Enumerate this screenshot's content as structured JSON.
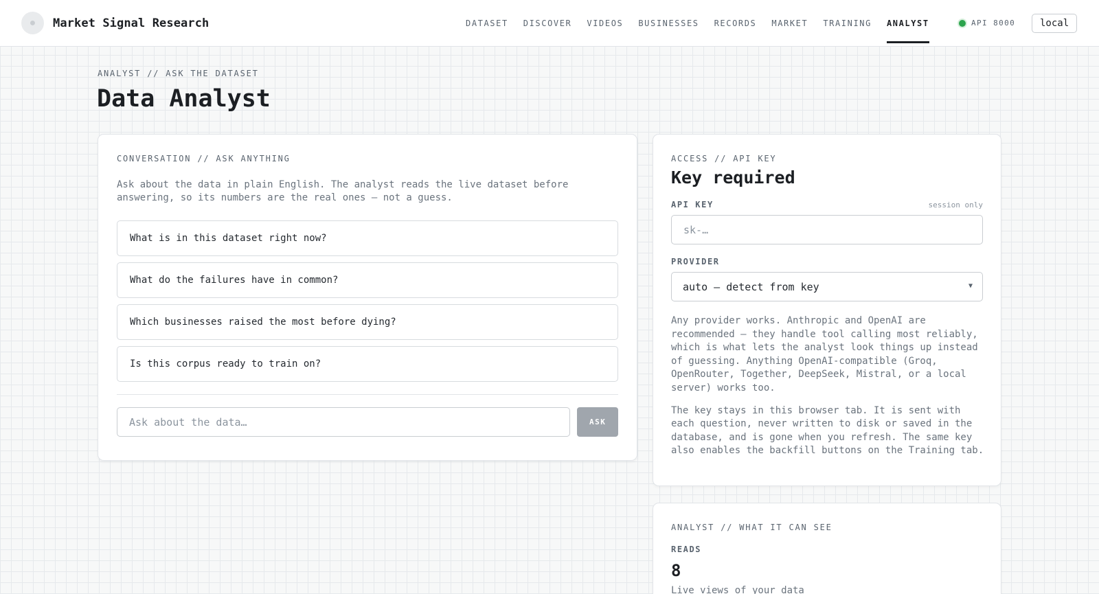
{
  "brand": {
    "name": "Market Signal Research",
    "logo_icon": "brand-logo-icon"
  },
  "nav": {
    "items": [
      {
        "label": "DATASET",
        "active": false
      },
      {
        "label": "DISCOVER",
        "active": false
      },
      {
        "label": "VIDEOS",
        "active": false
      },
      {
        "label": "BUSINESSES",
        "active": false
      },
      {
        "label": "RECORDS",
        "active": false
      },
      {
        "label": "MARKET",
        "active": false
      },
      {
        "label": "TRAINING",
        "active": false
      },
      {
        "label": "ANALYST",
        "active": true
      }
    ],
    "api_status": "API 8000",
    "api_status_color": "#2da44e",
    "env": "local"
  },
  "page": {
    "eyebrow": "ANALYST // ASK THE DATASET",
    "title": "Data Analyst"
  },
  "conversation": {
    "eyebrow": "CONVERSATION // ASK ANYTHING",
    "intro": "Ask about the data in plain English. The analyst reads the live dataset before answering, so its numbers are the real ones — not a guess.",
    "suggestions": [
      "What is in this dataset right now?",
      "What do the failures have in common?",
      "Which businesses raised the most before dying?",
      "Is this corpus ready to train on?"
    ],
    "input_placeholder": "Ask about the data…",
    "ask_label": "ASK"
  },
  "access": {
    "eyebrow": "ACCESS // API KEY",
    "title": "Key required",
    "api_key_label": "API KEY",
    "api_key_note": "session only",
    "api_key_placeholder": "sk-…",
    "provider_label": "PROVIDER",
    "provider_value": "auto — detect from key",
    "help_1": "Any provider works. Anthropic and OpenAI are recommended — they handle tool calling most reliably, which is what lets the analyst look things up instead of guessing. Anything OpenAI-compatible (Groq, OpenRouter, Together, DeepSeek, Mistral, or a local server) works too.",
    "help_2": "The key stays in this browser tab. It is sent with each question, never written to disk or saved in the database, and is gone when you refresh. The same key also enables the backfill buttons on the Training tab."
  },
  "sees": {
    "eyebrow": "ANALYST // WHAT IT CAN SEE",
    "reads_label": "READS",
    "reads_value": "8",
    "reads_sub": "Live views of your data"
  }
}
